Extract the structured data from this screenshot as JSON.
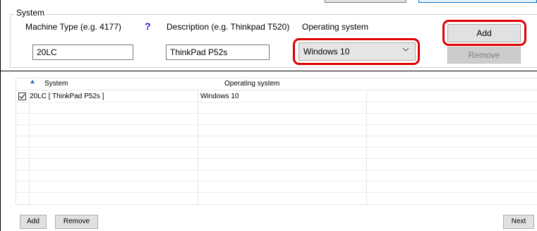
{
  "system_group": {
    "legend": "System",
    "machine_type_label": "Machine Type (e.g. 4177)",
    "help_icon": "?",
    "description_label": "Description (e.g. Thinkpad T520)",
    "os_label": "Operating system",
    "machine_type_value": "20LC",
    "description_value": "ThinkPad P52s",
    "os_selected": "Windows 10",
    "add_label": "Add",
    "remove_label": "Remove"
  },
  "list": {
    "columns": [
      "System",
      "Operating system"
    ],
    "rows": [
      {
        "checked": true,
        "system": "20LC [ ThinkPad P52s ]",
        "os": "Windows 10"
      }
    ]
  },
  "footer": {
    "add_label": "Add",
    "remove_label": "Remove",
    "next_label": "Next"
  },
  "colors": {
    "highlight": "#e00000",
    "help_icon": "#1a1ad9",
    "sort_arrow": "#2a64c8"
  }
}
